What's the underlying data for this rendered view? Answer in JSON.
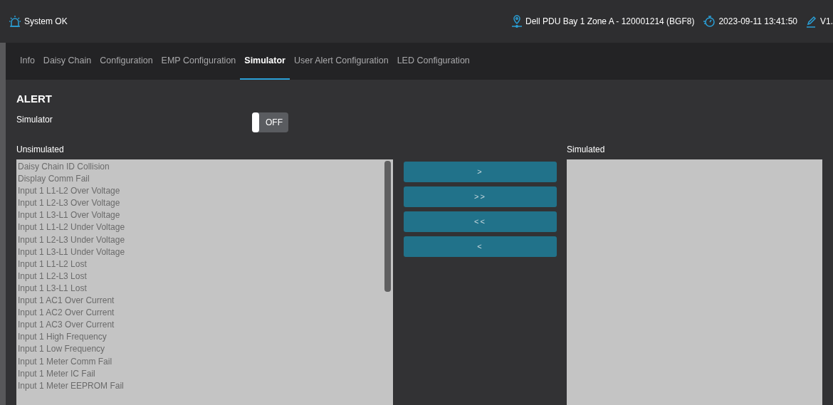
{
  "header": {
    "status": "System OK",
    "device": "Dell PDU Bay 1 Zone A - 120001214 (BGF8)",
    "datetime": "2023-09-11 13:41:50",
    "version": "V1."
  },
  "tabs": [
    {
      "label": "Info",
      "selected": false
    },
    {
      "label": "Daisy Chain",
      "selected": false
    },
    {
      "label": "Configuration",
      "selected": false
    },
    {
      "label": "EMP Configuration",
      "selected": false
    },
    {
      "label": "Simulator",
      "selected": true
    },
    {
      "label": "User Alert Configuration",
      "selected": false
    },
    {
      "label": "LED Configuration",
      "selected": false
    }
  ],
  "section_title": "ALERT",
  "simulator": {
    "label": "Simulator",
    "on": false,
    "state_text": "OFF"
  },
  "unsimulated": {
    "label": "Unsimulated",
    "items": [
      "Daisy Chain ID Collision",
      "Display Comm Fail",
      "Input 1 L1-L2 Over Voltage",
      "Input 1 L2-L3 Over Voltage",
      "Input 1 L3-L1 Over Voltage",
      "Input 1 L1-L2 Under Voltage",
      "Input 1 L2-L3 Under Voltage",
      "Input 1 L3-L1 Under Voltage",
      "Input 1 L1-L2 Lost",
      "Input 1 L2-L3 Lost",
      "Input 1 L3-L1 Lost",
      "Input 1 AC1 Over Current",
      "Input 1 AC2 Over Current",
      "Input 1 AC3 Over Current",
      "Input 1 High Frequency",
      "Input 1 Low Frequency",
      "Input 1 Meter Comm Fail",
      "Input 1 Meter IC Fail",
      "Input 1 Meter EEPROM Fail"
    ]
  },
  "move_buttons": [
    ">",
    ">>",
    "<<",
    "<"
  ],
  "simulated": {
    "label": "Simulated"
  }
}
